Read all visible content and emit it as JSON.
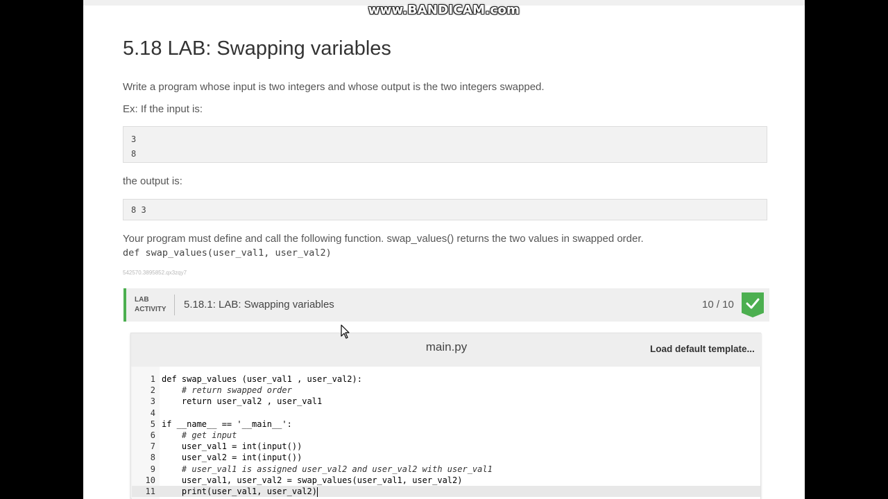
{
  "watermark": "www.BANDICAM.com",
  "lesson": {
    "title": "5.18 LAB: Swapping variables",
    "intro": "Write a program whose input is two integers and whose output is the two integers swapped.",
    "ex_label": "Ex: If the input is:",
    "input_example": "3\n8",
    "output_label": "the output is:",
    "output_example": "8 3",
    "requirement": "Your program must define and call the following function. swap_values() returns the two values in swapped order.",
    "signature": "def swap_values(user_val1, user_val2)",
    "tracking_id": "542570.3895852.qx3zqy7"
  },
  "lab": {
    "label_line1": "LAB",
    "label_line2": "ACTIVITY",
    "title": "5.18.1: LAB: Swapping variables",
    "score": "10 / 10",
    "accent_color": "#4caf50"
  },
  "editor": {
    "filename": "main.py",
    "load_template_label": "Load default template...",
    "active_line": 11,
    "lines": [
      {
        "n": "1",
        "text": "def swap_values (user_val1 , user_val2):"
      },
      {
        "n": "2",
        "text": "    # return swapped order"
      },
      {
        "n": "3",
        "text": "    return user_val2 , user_val1"
      },
      {
        "n": "4",
        "text": ""
      },
      {
        "n": "5",
        "text": "if __name__ == '__main__':"
      },
      {
        "n": "6",
        "text": "    # get input"
      },
      {
        "n": "7",
        "text": "    user_val1 = int(input())"
      },
      {
        "n": "8",
        "text": "    user_val2 = int(input())"
      },
      {
        "n": "9",
        "text": "    # user_val1 is assigned user_val2 and user_val2 with user_val1"
      },
      {
        "n": "10",
        "text": "    user_val1, user_val2 = swap_values(user_val1, user_val2)"
      },
      {
        "n": "11",
        "text": "    print(user_val1, user_val2)"
      }
    ]
  },
  "icons": {
    "check": "check-icon",
    "cursor": "mouse-pointer-icon"
  }
}
